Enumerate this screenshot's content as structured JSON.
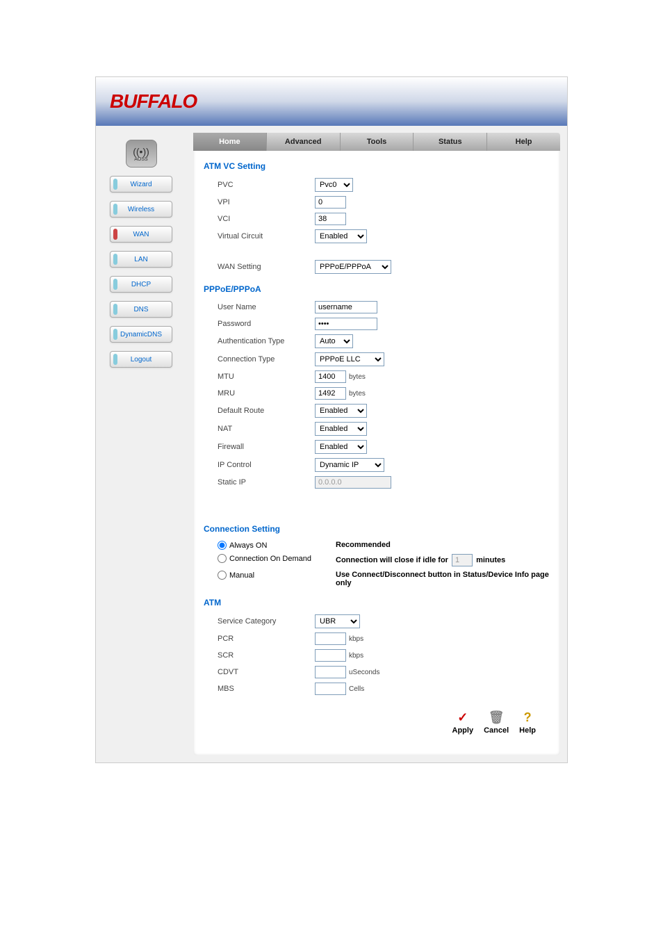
{
  "logo": "BUFFALO",
  "aoss_label": "AOSS",
  "nav": {
    "home": "Home",
    "advanced": "Advanced",
    "tools": "Tools",
    "status": "Status",
    "help": "Help"
  },
  "sidebar": {
    "wizard": "Wizard",
    "wireless": "Wireless",
    "wan": "WAN",
    "lan": "LAN",
    "dhcp": "DHCP",
    "dns": "DNS",
    "dynamicdns": "DynamicDNS",
    "logout": "Logout"
  },
  "sections": {
    "atm_vc": "ATM VC Setting",
    "pppoe": "PPPoE/PPPoA",
    "conn": "Connection Setting",
    "atm": "ATM"
  },
  "atm_vc": {
    "pvc_label": "PVC",
    "pvc_value": "Pvc0",
    "vpi_label": "VPI",
    "vpi_value": "0",
    "vci_label": "VCI",
    "vci_value": "38",
    "virtual_circuit_label": "Virtual Circuit",
    "virtual_circuit_value": "Enabled",
    "wan_setting_label": "WAN Setting",
    "wan_setting_value": "PPPoE/PPPoA"
  },
  "pppoe": {
    "user_name_label": "User Name",
    "user_name_value": "username",
    "password_label": "Password",
    "password_value": "••••",
    "auth_type_label": "Authentication Type",
    "auth_type_value": "Auto",
    "conn_type_label": "Connection Type",
    "conn_type_value": "PPPoE LLC",
    "mtu_label": "MTU",
    "mtu_value": "1400",
    "mtu_unit": "bytes",
    "mru_label": "MRU",
    "mru_value": "1492",
    "mru_unit": "bytes",
    "default_route_label": "Default Route",
    "default_route_value": "Enabled",
    "nat_label": "NAT",
    "nat_value": "Enabled",
    "firewall_label": "Firewall",
    "firewall_value": "Enabled",
    "ip_control_label": "IP Control",
    "ip_control_value": "Dynamic IP",
    "static_ip_label": "Static IP",
    "static_ip_value": "0.0.0.0"
  },
  "conn": {
    "always_on": "Always ON",
    "recommended": "Recommended",
    "on_demand": "Connection On Demand",
    "idle_text_1": "Connection will close if idle for",
    "idle_value": "1",
    "idle_text_2": "minutes",
    "manual": "Manual",
    "manual_note": "Use Connect/Disconnect button in Status/Device Info page only"
  },
  "atm": {
    "service_cat_label": "Service Category",
    "service_cat_value": "UBR",
    "pcr_label": "PCR",
    "pcr_value": "",
    "pcr_unit": "kbps",
    "scr_label": "SCR",
    "scr_value": "",
    "scr_unit": "kbps",
    "cdvt_label": "CDVT",
    "cdvt_value": "",
    "cdvt_unit": "uSeconds",
    "mbs_label": "MBS",
    "mbs_value": "",
    "mbs_unit": "Cells"
  },
  "actions": {
    "apply": "Apply",
    "cancel": "Cancel",
    "help": "Help"
  }
}
